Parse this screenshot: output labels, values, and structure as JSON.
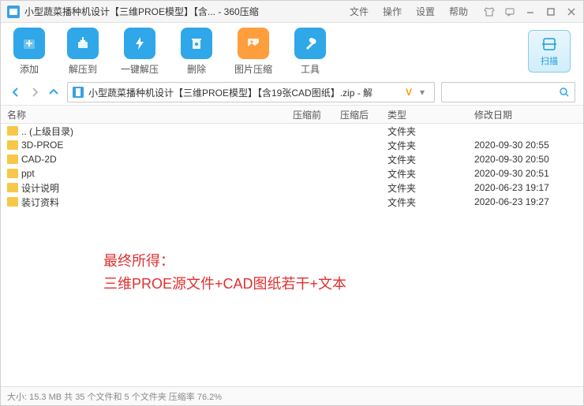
{
  "titlebar": {
    "title": "小型蔬菜播种机设计【三维PROE模型】【含... - 360压缩",
    "menu": {
      "file": "文件",
      "operate": "操作",
      "settings": "设置",
      "help": "帮助"
    }
  },
  "toolbar": {
    "add": "添加",
    "extract_to": "解压到",
    "one_click": "一键解压",
    "delete": "删除",
    "image_compress": "图片压缩",
    "tools": "工具",
    "scan": "扫描"
  },
  "path": {
    "text": "小型蔬菜播种机设计【三维PROE模型】【含19张CAD图纸】.zip - 解",
    "badge": "V"
  },
  "columns": {
    "name": "名称",
    "before": "压缩前",
    "after": "压缩后",
    "type": "类型",
    "date": "修改日期"
  },
  "rows": [
    {
      "name": ".. (上级目录)",
      "type": "文件夹",
      "date": ""
    },
    {
      "name": "3D-PROE",
      "type": "文件夹",
      "date": "2020-09-30 20:55"
    },
    {
      "name": "CAD-2D",
      "type": "文件夹",
      "date": "2020-09-30 20:50"
    },
    {
      "name": "ppt",
      "type": "文件夹",
      "date": "2020-09-30 20:51"
    },
    {
      "name": "设计说明",
      "type": "文件夹",
      "date": "2020-06-23 19:17"
    },
    {
      "name": "装订资料",
      "type": "文件夹",
      "date": "2020-06-23 19:27"
    }
  ],
  "annotation": {
    "line1": "最终所得：",
    "line2": "三维PROE源文件+CAD图纸若干+文本"
  },
  "status": "大小: 15.3 MB 共 35 个文件和 5 个文件夹 压缩率 76.2%"
}
